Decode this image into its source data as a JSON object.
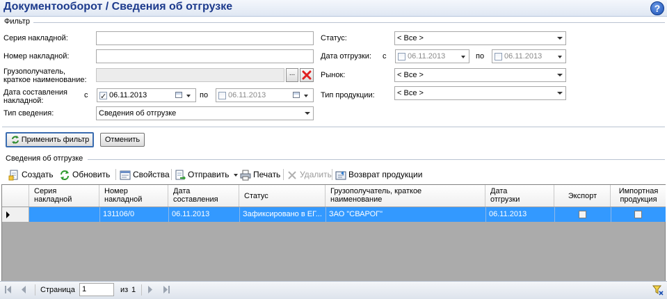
{
  "header": {
    "title": "Документооборот  / Сведения об отгрузке",
    "help_label": "?"
  },
  "filter": {
    "group_label": "Фильтр",
    "series_label": "Серия накладной:",
    "series_value": "",
    "number_label": "Номер накладной:",
    "number_value": "",
    "consignee_label_1": "Грузополучатель,",
    "consignee_label_2": "краткое наименование:",
    "consignee_value": "",
    "browse_label": "...",
    "created_label_1": "Дата составления",
    "created_label_2": "накладной:",
    "from_label": "с",
    "to_label": "по",
    "created_from": "06.11.2013",
    "created_from_checked": true,
    "created_to": "06.11.2013",
    "created_to_checked": false,
    "type_label": "Тип сведения:",
    "type_value": "Сведения об отгрузке",
    "status_label": "Статус:",
    "status_value": "< Все >",
    "ship_date_label": "Дата отгрузки:",
    "ship_from": "06.11.2013",
    "ship_to": "06.11.2013",
    "market_label": "Рынок:",
    "market_value": "< Все >",
    "product_type_label": "Тип продукции:",
    "product_type_value": "< Все >",
    "apply_label": "Применить фильтр",
    "cancel_label": "Отменить"
  },
  "section": {
    "label": "Сведения об отгрузке"
  },
  "toolbar": {
    "create": "Создать",
    "refresh": "Обновить",
    "properties": "Свойства",
    "send": "Отправить",
    "print": "Печать",
    "delete": "Удалить",
    "return": "Возврат продукции"
  },
  "grid": {
    "columns": [
      {
        "l1": "Серия",
        "l2": "накладной"
      },
      {
        "l1": "Номер",
        "l2": "накладной"
      },
      {
        "l1": "Дата",
        "l2": "составления"
      },
      {
        "l1": "Статус",
        "l2": ""
      },
      {
        "l1": "Грузополучатель, краткое",
        "l2": "наименование"
      },
      {
        "l1": "Дата",
        "l2": "отгрузки"
      },
      {
        "l1": "Экспорт",
        "l2": ""
      },
      {
        "l1": "Импортная",
        "l2": "продукция"
      }
    ],
    "rows": [
      {
        "series": "",
        "number": "131106/0",
        "created": "06.11.2013",
        "status": "Зафиксировано в ЕГ...",
        "consignee": "ЗАО \"СВАРОГ\"",
        "ship_date": "06.11.2013",
        "export": false,
        "import": false
      }
    ]
  },
  "pager": {
    "page_label": "Страница",
    "page_value": "1",
    "of_label": "из",
    "total_pages": "1"
  },
  "colors": {
    "title": "#1c3a8c",
    "selection": "#3399ff",
    "delete_icon": "#e02020"
  }
}
